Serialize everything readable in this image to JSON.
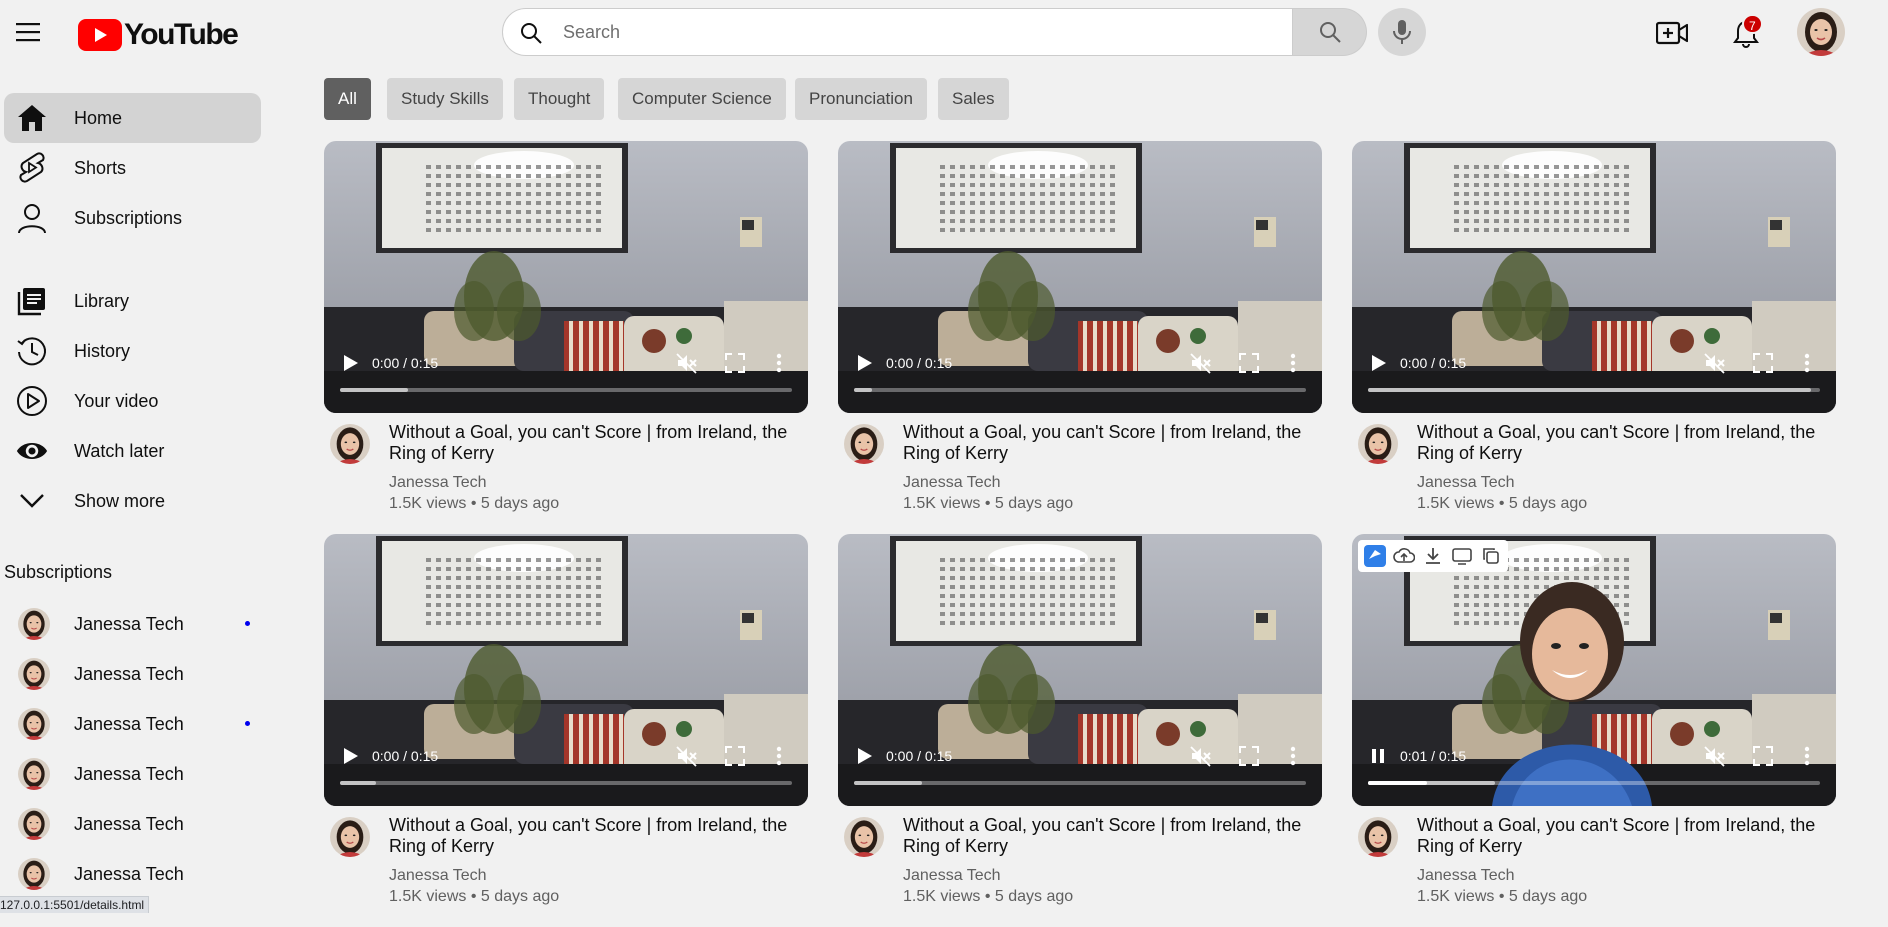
{
  "header": {
    "logo_text": "YouTube",
    "search_placeholder": "Search",
    "notification_count": "7"
  },
  "sidebar": {
    "main": [
      {
        "label": "Home",
        "icon": "home-icon",
        "active": true
      },
      {
        "label": "Shorts",
        "icon": "shorts-icon"
      },
      {
        "label": "Subscriptions",
        "icon": "subscriptions-icon"
      }
    ],
    "library": [
      {
        "label": "Library",
        "icon": "library-icon"
      },
      {
        "label": "History",
        "icon": "history-icon"
      },
      {
        "label": "Your video",
        "icon": "your-video-icon"
      },
      {
        "label": "Watch later",
        "icon": "watch-later-icon"
      },
      {
        "label": "Show more",
        "icon": "chevron-down-icon"
      }
    ],
    "subscriptions_heading": "Subscriptions",
    "subscriptions": [
      {
        "label": "Janessa Tech",
        "new": true
      },
      {
        "label": "Janessa Tech",
        "new": false
      },
      {
        "label": "Janessa Tech",
        "new": true
      },
      {
        "label": "Janessa Tech",
        "new": false
      },
      {
        "label": "Janessa Tech",
        "new": false
      },
      {
        "label": "Janessa Tech",
        "new": false
      }
    ]
  },
  "chips": [
    "All",
    "Study Skills",
    "Thought",
    "Computer Science",
    "Pronunciation",
    "Sales"
  ],
  "videos": [
    {
      "title": "Without a Goal, you can't Score | from Ireland, the Ring of Kerry",
      "channel": "Janessa Tech",
      "meta": "1.5K views • 5 days ago",
      "time": "0:00 / 0:15",
      "playing": false,
      "buffered": 0.15,
      "played": 0
    },
    {
      "title": "Without a Goal, you can't Score | from Ireland, the Ring of Kerry",
      "channel": "Janessa Tech",
      "meta": "1.5K views • 5 days ago",
      "time": "0:00 / 0:15",
      "playing": false,
      "buffered": 0.04,
      "played": 0
    },
    {
      "title": "Without a Goal, you can't Score | from Ireland, the Ring of Kerry",
      "channel": "Janessa Tech",
      "meta": "1.5K views • 5 days ago",
      "time": "0:00 / 0:15",
      "playing": false,
      "buffered": 0.98,
      "played": 0
    },
    {
      "title": "Without a Goal, you can't Score | from Ireland, the Ring of Kerry",
      "channel": "Janessa Tech",
      "meta": "1.5K views • 5 days ago",
      "time": "0:00 / 0:15",
      "playing": false,
      "buffered": 0.08,
      "played": 0
    },
    {
      "title": "Without a Goal, you can't Score | from Ireland, the Ring of Kerry",
      "channel": "Janessa Tech",
      "meta": "1.5K views • 5 days ago",
      "time": "0:00 / 0:15",
      "playing": false,
      "buffered": 0.15,
      "played": 0
    },
    {
      "title": "Without a Goal, you can't Score | from Ireland, the Ring of Kerry",
      "channel": "Janessa Tech",
      "meta": "1.5K views • 5 days ago",
      "time": "0:01 / 0:15",
      "playing": true,
      "buffered": 0.28,
      "played": 0.13
    }
  ],
  "status_url": "127.0.0.1:5501/details.html",
  "colors": {
    "brand_red": "#ff0000",
    "badge_red": "#cc0000",
    "new_dot": "#0000ee"
  }
}
